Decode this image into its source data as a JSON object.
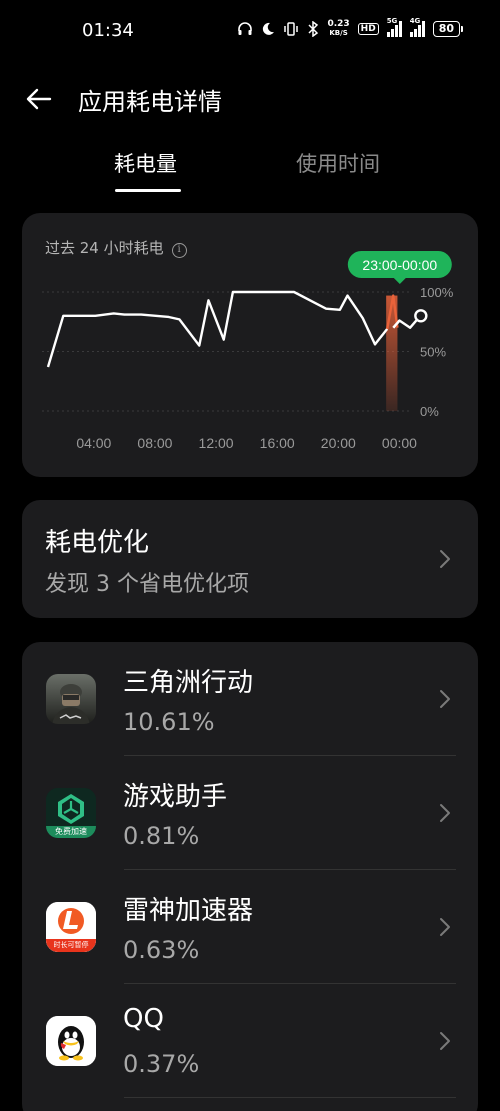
{
  "status_bar": {
    "time": "01:34",
    "net_speed_value": "0.23",
    "net_speed_unit": "KB/S",
    "hd_label": "HD",
    "signal1_gen": "5G",
    "signal2_gen": "4G",
    "battery": "80",
    "icons": [
      "headphones-icon",
      "moon-icon",
      "vibrate-icon",
      "bluetooth-icon"
    ]
  },
  "header": {
    "title": "应用耗电详情"
  },
  "tabs": [
    {
      "label": "耗电量",
      "active": true
    },
    {
      "label": "使用时间",
      "active": false
    }
  ],
  "chart": {
    "title": "过去 24 小时耗电",
    "info_glyph": "i",
    "tooltip": "23:00-00:00",
    "accent_color": "#1fb45a",
    "highlight_color": "#e8623a"
  },
  "chart_data": {
    "type": "line",
    "title": "过去 24 小时耗电",
    "x_ticks": [
      "04:00",
      "08:00",
      "12:00",
      "16:00",
      "20:00",
      "00:00"
    ],
    "y_ticks": [
      "100%",
      "50%",
      "0%"
    ],
    "ylim": [
      0,
      100
    ],
    "xlim": [
      1.0,
      26.0
    ],
    "grid": true,
    "highlight_range": [
      "23:00",
      "00:00"
    ],
    "series": [
      {
        "x": [
          1.0,
          2.0,
          4.1,
          5.3,
          6.0,
          7.1,
          8.9,
          9.6,
          10.9,
          11.5,
          12.5,
          13.1,
          14.1,
          15.3,
          16.1,
          17.1,
          18.6,
          19.2,
          20.1,
          20.6,
          21.6,
          22.4,
          23.2,
          23.6,
          24.0,
          24.7,
          25.1,
          25.4
        ],
        "y": [
          37,
          80,
          80,
          82,
          81,
          81,
          79,
          77,
          55,
          93,
          60,
          100,
          100,
          100,
          100,
          100,
          90,
          86,
          85,
          97,
          78,
          56,
          69,
          70,
          76,
          70,
          76,
          80
        ]
      }
    ]
  },
  "optimize": {
    "title": "耗电优化",
    "subtitle": "发现 3 个省电优化项"
  },
  "apps": [
    {
      "name": "三角洲行动",
      "percent": "10.61%",
      "icon": "delta-force-app-icon"
    },
    {
      "name": "游戏助手",
      "percent": "0.81%",
      "icon": "game-assistant-app-icon",
      "icon_caption": "免费加速"
    },
    {
      "name": "雷神加速器",
      "percent": "0.63%",
      "icon": "leishen-accelerator-app-icon",
      "icon_caption": "时长可暂停"
    },
    {
      "name": "QQ",
      "percent": "0.37%",
      "icon": "qq-app-icon"
    }
  ]
}
